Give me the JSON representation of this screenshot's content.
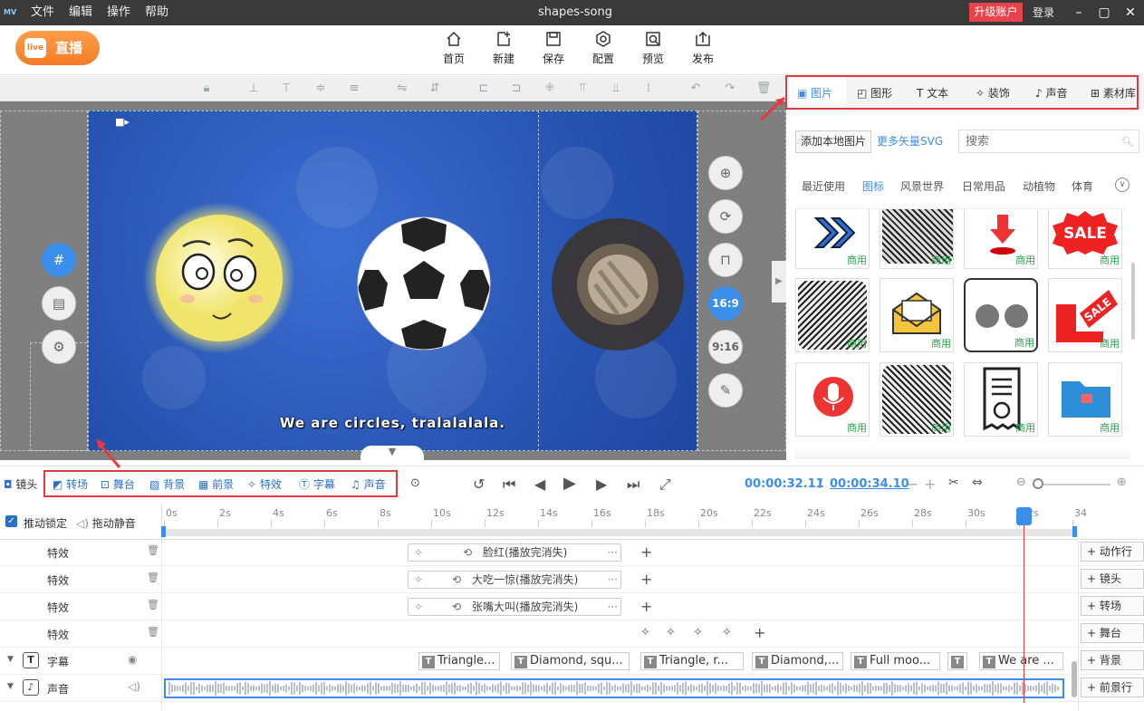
{
  "titlebar": {
    "logo": "MV",
    "menus": [
      "文件",
      "编辑",
      "操作",
      "帮助"
    ],
    "title": "shapes-song",
    "upgrade": "升级账户",
    "login": "登录"
  },
  "toolbar": {
    "live": "直播",
    "live_badge": "live",
    "items": [
      "首页",
      "新建",
      "保存",
      "配置",
      "预览",
      "发布"
    ]
  },
  "stage": {
    "subtitle": "We are circles, tralalalala.",
    "ratio_169": "16:9",
    "ratio_916": "9:16"
  },
  "panel": {
    "tabs": [
      "图片",
      "图形",
      "文本",
      "装饰",
      "声音",
      "素材库"
    ],
    "add_local": "添加本地图片",
    "more_svg": "更多矢量SVG",
    "search_placeholder": "搜索",
    "categories": [
      "最近使用",
      "图标",
      "风景世界",
      "日常用品",
      "动植物",
      "体育"
    ],
    "commercial": "商用",
    "sale": "SALE"
  },
  "timeline": {
    "lens": "镜头",
    "tools": [
      "转场",
      "舞台",
      "背景",
      "前景",
      "特效",
      "字幕",
      "声音"
    ],
    "current_time": "00:00:32.11",
    "separator": "/",
    "total_time": "00:00:34.10",
    "lock_label": "推动锁定",
    "mute_label": "拖动静音",
    "ticks": [
      "0s",
      "2s",
      "4s",
      "6s",
      "8s",
      "10s",
      "12s",
      "14s",
      "16s",
      "18s",
      "20s",
      "22s",
      "24s",
      "26s",
      "28s",
      "30s",
      "32s",
      "34"
    ],
    "rows": {
      "effect": "特效",
      "subtitle": "字幕",
      "sound": "声音"
    },
    "effects": [
      "脸红(播放完消失)",
      "大吃一惊(播放完消失)",
      "张嘴大叫(播放完消失)"
    ],
    "subtitles": [
      "Triangle...",
      "Diamond, squ...",
      "Triangle, r...",
      "Diamond,...",
      "Full moo...",
      "",
      "We are ..."
    ],
    "right_buttons": [
      "动作行",
      "镜头",
      "转场",
      "舞台",
      "背景",
      "前景行"
    ]
  }
}
